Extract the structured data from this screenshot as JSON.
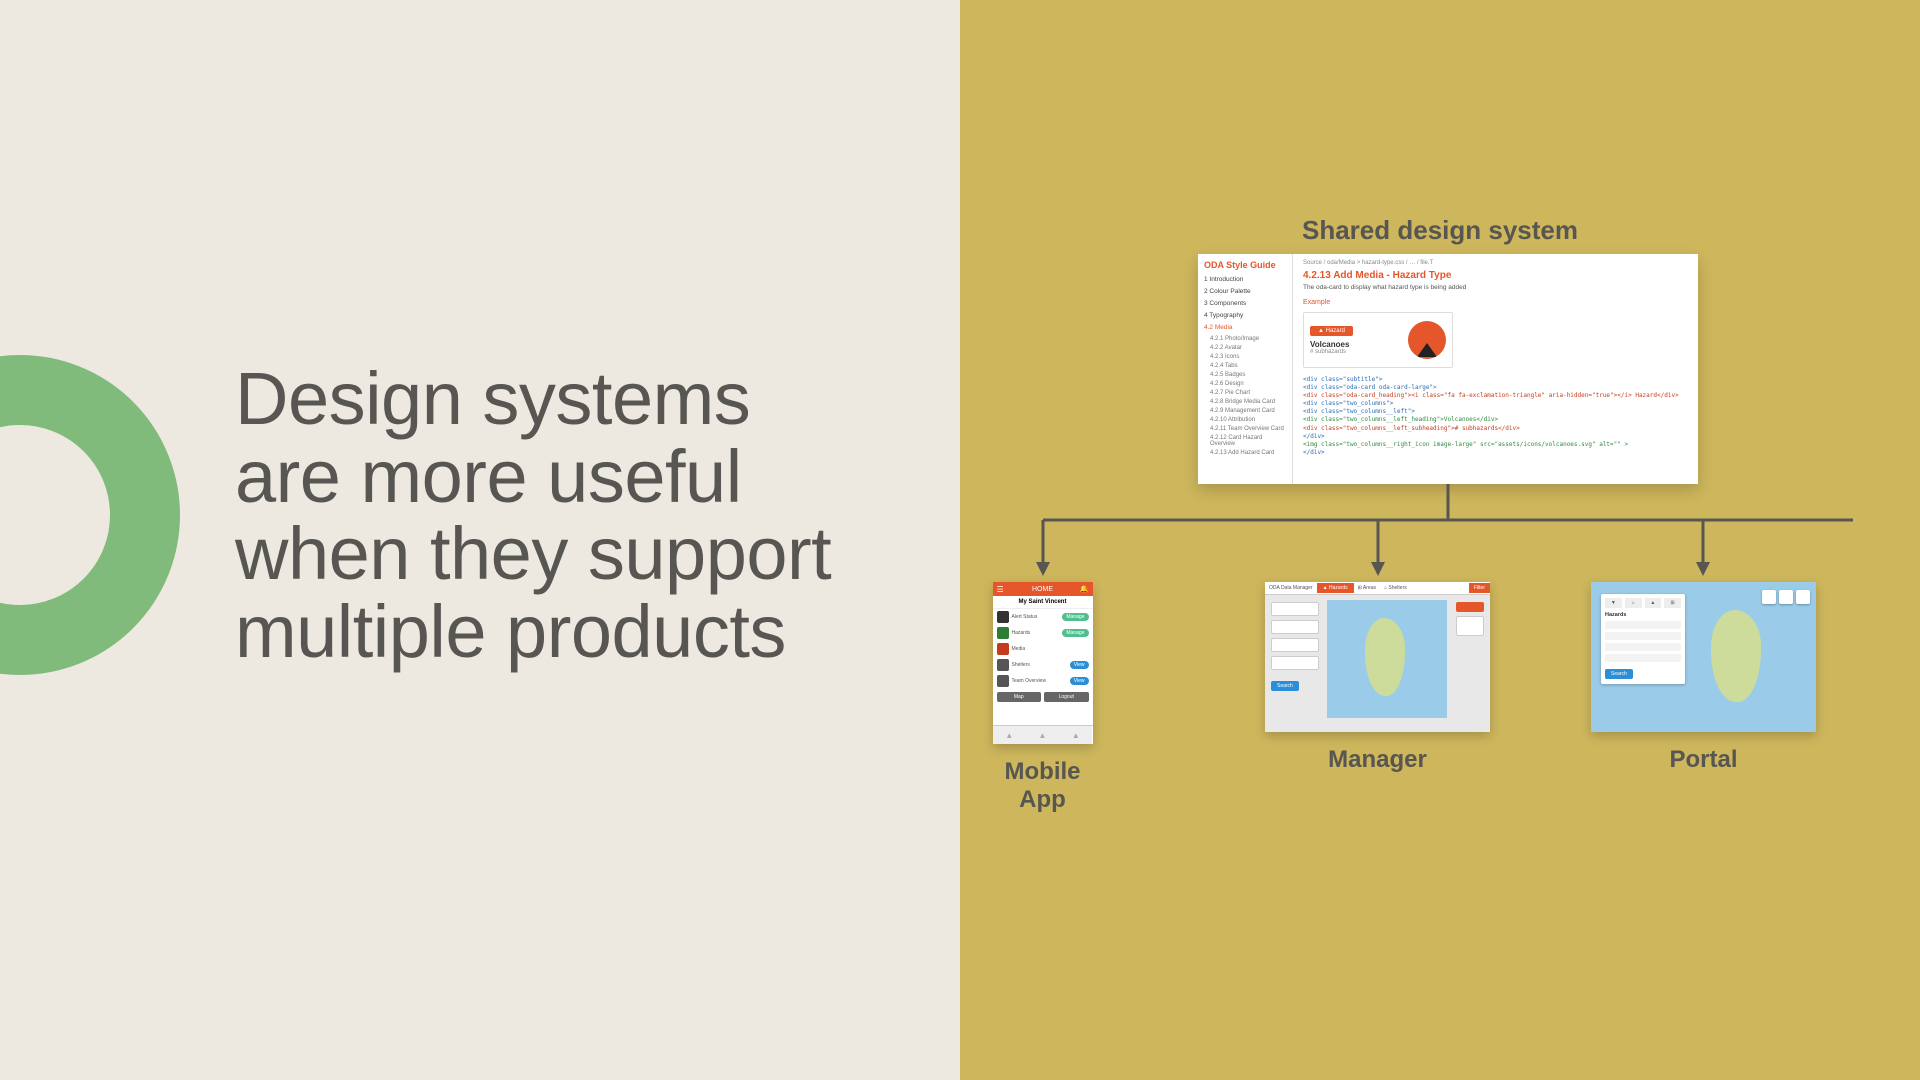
{
  "headline": "Design systems are more useful when they support multiple products",
  "shared_label": "Shared design system",
  "products": {
    "mobile": "Mobile App",
    "manager": "Manager",
    "portal": "Portal"
  },
  "styleguide": {
    "title": "ODA Style Guide",
    "nav": {
      "n1": "1 Introduction",
      "n2": "2 Colour Palette",
      "n3": "3 Components",
      "n4": "4 Typography",
      "active": "4.2 Media",
      "subs": [
        "4.2.1 Photo/Image",
        "4.2.2 Avatar",
        "4.2.3 Icons",
        "4.2.4 Tabs",
        "4.2.5 Badges",
        "4.2.6 Design",
        "4.2.7 Pie Chart",
        "4.2.8 Bridge Media Card",
        "4.2.9 Management Card",
        "4.2.10 Attribution",
        "4.2.11 Team Overview Card",
        "4.2.12 Card Hazard Overview",
        "4.2.13 Add Hazard Card"
      ]
    },
    "breadcrumb": "Source / oda/Media > hazard-type.css / … / file.T",
    "section_title": "4.2.13 Add Media - Hazard Type",
    "section_sub": "The oda-card to display what hazard type is being added",
    "example_label": "Example",
    "card": {
      "chip": "▲ Hazard",
      "name": "Volcanoes",
      "sub": "# subhazards"
    },
    "code": {
      "l1": "<div class=\"subtitle\">",
      "l2": "  <div class=\"oda-card oda-card-large\">",
      "l3": "    <div class=\"oda-card_heading\"><i class=\"fa fa-exclamation-triangle\" aria-hidden=\"true\"></i> Hazard</div>",
      "l4": "    <div class=\"two_columns\">",
      "l5": "      <div class=\"two_columns__left\">",
      "l6": "        <div class=\"two_columns__left_heading\">Volcanoes</div>",
      "l7": "        <div class=\"two_columns__left_subheading\"># subhazards</div>",
      "l8": "      </div>",
      "l9": "      <img class=\"two_columns__right_icon image-large\" src=\"assets/icons/volcanoes.svg\" alt=\"\" >",
      "l10": "    </div>"
    }
  },
  "mobile": {
    "title": "HOME",
    "subtitle": "My Saint Vincent",
    "rows": [
      {
        "label": "Alert Status",
        "btn": "Manage",
        "btnColor": "#4fc08d",
        "ico": "#333"
      },
      {
        "label": "Hazards",
        "btn": "Manage",
        "btnColor": "#4fc08d",
        "ico": "#2e7d32"
      },
      {
        "label": "Media",
        "btn": "",
        "btnColor": "",
        "ico": "#c43b1d"
      },
      {
        "label": "Shelters",
        "btn": "View",
        "btnColor": "#2a8fd6",
        "ico": "#555"
      },
      {
        "label": "Team Overview",
        "btn": "View",
        "btnColor": "#2a8fd6",
        "ico": "#555"
      }
    ],
    "foot_left": "Map",
    "foot_right": "Logout"
  },
  "manager": {
    "title": "ODA Data Manager",
    "tab": "▲ Hazards",
    "t2": "⊞ Areas",
    "t3": "⌂ Shelters",
    "btn": "Search",
    "rbtn": "Filter"
  },
  "portal": {
    "tab1": "▼",
    "tab2": "⌂",
    "tab3": "▲",
    "tab4": "⊞",
    "section": "Hazards",
    "btn": "Search"
  }
}
